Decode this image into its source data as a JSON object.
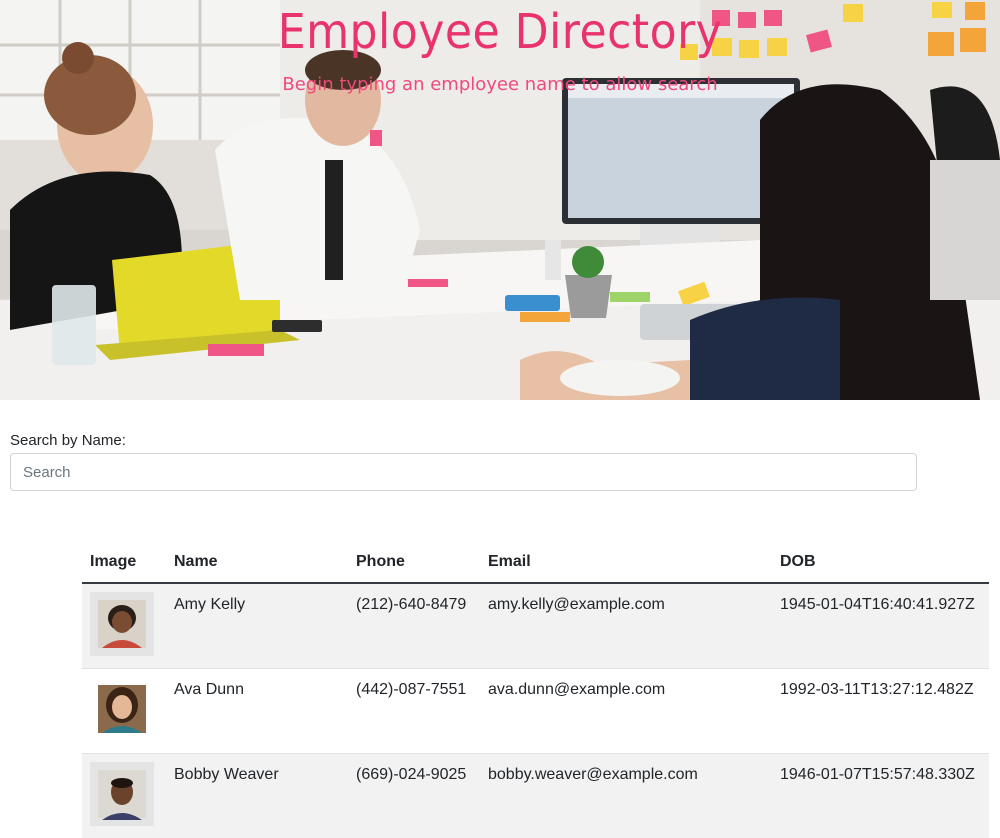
{
  "hero": {
    "title": "Employee Directory",
    "subtitle": "Begin typing an employee name to allow search",
    "title_color": "#e8336c"
  },
  "search": {
    "label": "Search by Name:",
    "placeholder": "Search",
    "value": ""
  },
  "table": {
    "headers": [
      "Image",
      "Name",
      "Phone",
      "Email",
      "DOB"
    ],
    "rows": [
      {
        "name": "Amy Kelly",
        "phone": "(212)-640-8479",
        "email": "amy.kelly@example.com",
        "dob": "1945-01-04T16:40:41.927Z"
      },
      {
        "name": "Ava Dunn",
        "phone": "(442)-087-7551",
        "email": "ava.dunn@example.com",
        "dob": "1992-03-11T13:27:12.482Z"
      },
      {
        "name": "Bobby Weaver",
        "phone": "(669)-024-9025",
        "email": "bobby.weaver@example.com",
        "dob": "1946-01-07T15:57:48.330Z"
      }
    ]
  }
}
